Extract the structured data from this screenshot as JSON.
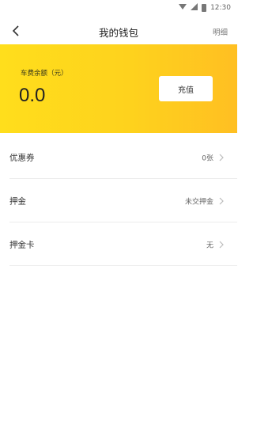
{
  "status_bar": {
    "time": "12:30"
  },
  "header": {
    "title": "我的钱包",
    "detail_label": "明细"
  },
  "balance": {
    "label": "车费余额（元）",
    "amount": "0.0",
    "recharge_label": "充值"
  },
  "list": [
    {
      "label": "优惠券",
      "value": "0张"
    },
    {
      "label": "押金",
      "value": "未交押金"
    },
    {
      "label": "押金卡",
      "value": "无"
    }
  ],
  "colors": {
    "card_start": "#ffde1c",
    "card_end": "#ffbf22"
  }
}
